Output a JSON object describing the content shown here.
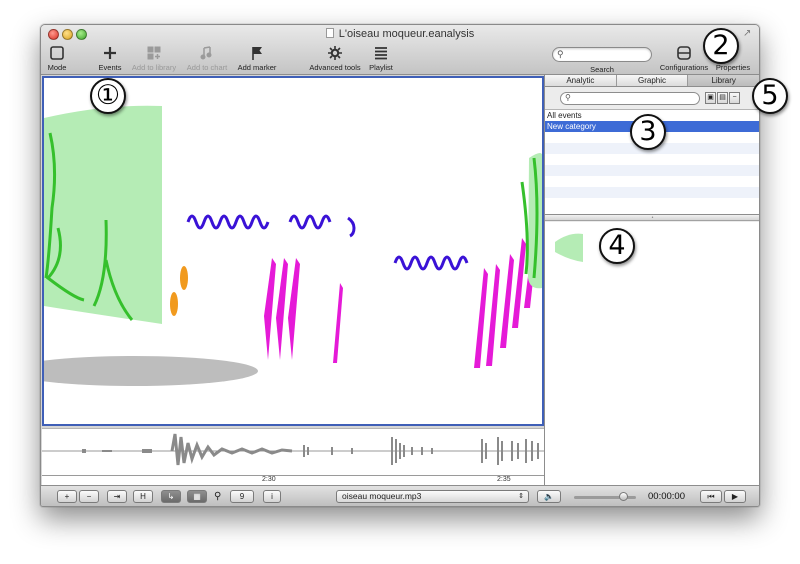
{
  "window": {
    "title": "L'oiseau moqueur.eanalysis",
    "fullscreen_icon": "↗"
  },
  "toolbar": {
    "mode": "Mode",
    "events": "Events",
    "add_to_library": "Add to library",
    "add_to_chart": "Add to chart",
    "add_marker": "Add marker",
    "advanced_tools": "Advanced tools",
    "playlist": "Playlist",
    "search_label": "Search",
    "configurations": "Configurations",
    "properties": "Properties"
  },
  "panel": {
    "tabs": [
      "Analytic",
      "Graphic",
      "Library"
    ],
    "active_tab": "Library",
    "library_items": [
      "All events",
      "New category"
    ],
    "selected_item": "New category"
  },
  "overview": {
    "ticks": [
      "2:30",
      "2:35"
    ]
  },
  "bottom_bar": {
    "zoom_value": "9",
    "info_button": "i",
    "file_name": "oiseau moqueur.mp3",
    "time": "00:00:00"
  },
  "callouts": [
    "①",
    "2",
    "3",
    "4",
    "5"
  ],
  "colors": {
    "selection_blue": "#3d6bd6",
    "view_border": "#3f5fb7",
    "green_fill": "#b5ecb5",
    "green_line": "#35c02c",
    "blue_wave": "#3a12d6",
    "magenta": "#e51ad7",
    "orange": "#f19a1e",
    "gray_shape": "#bdbdbd"
  }
}
